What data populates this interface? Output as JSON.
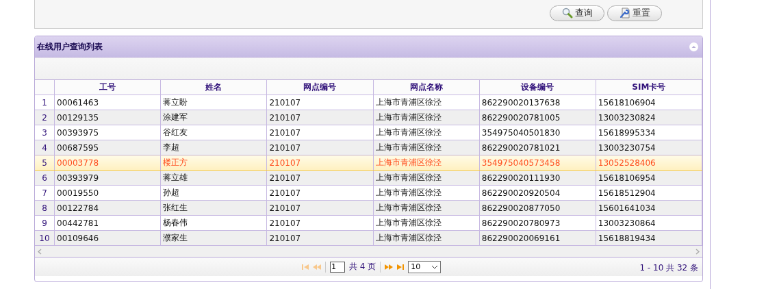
{
  "search_buttons": [
    {
      "kind": "search",
      "label": "查询"
    },
    {
      "kind": "reset",
      "label": "重置"
    }
  ],
  "grid": {
    "title": "在线用户查询列表",
    "columns": [
      "工号",
      "姓名",
      "网点编号",
      "网点名称",
      "设备编号",
      "SIM卡号"
    ],
    "rows": [
      {
        "index": "1",
        "cells": [
          "00061463",
          "蒋立盼",
          "210107",
          "上海市青浦区徐泾",
          "862290020137638",
          "15618106904"
        ],
        "selected": false
      },
      {
        "index": "2",
        "cells": [
          "00129135",
          "涂建军",
          "210107",
          "上海市青浦区徐泾",
          "862290020781005",
          "13003230824"
        ],
        "selected": false
      },
      {
        "index": "3",
        "cells": [
          "00393975",
          "谷红友",
          "210107",
          "上海市青浦区徐泾",
          "354975040501830",
          "15618995334"
        ],
        "selected": false
      },
      {
        "index": "4",
        "cells": [
          "00687595",
          "李超",
          "210107",
          "上海市青浦区徐泾",
          "862290020781021",
          "13003230754"
        ],
        "selected": false
      },
      {
        "index": "5",
        "cells": [
          "00003778",
          "楼正方",
          "210107",
          "上海市青浦区徐泾",
          "354975040573458",
          "13052528406"
        ],
        "selected": true
      },
      {
        "index": "6",
        "cells": [
          "00393979",
          "蒋立雄",
          "210107",
          "上海市青浦区徐泾",
          "862290020111930",
          "15618106954"
        ],
        "selected": false
      },
      {
        "index": "7",
        "cells": [
          "00019550",
          "孙超",
          "210107",
          "上海市青浦区徐泾",
          "862290020920504",
          "15618512904"
        ],
        "selected": false
      },
      {
        "index": "8",
        "cells": [
          "00122784",
          "张红生",
          "210107",
          "上海市青浦区徐泾",
          "862290020877050",
          "15601641034"
        ],
        "selected": false
      },
      {
        "index": "9",
        "cells": [
          "00442781",
          "杨春伟",
          "210107",
          "上海市青浦区徐泾",
          "862290020780973",
          "13003230864"
        ],
        "selected": false
      },
      {
        "index": "10",
        "cells": [
          "00109646",
          "濮家生",
          "210107",
          "上海市青浦区徐泾",
          "862290020069161",
          "15618819434"
        ],
        "selected": false
      }
    ],
    "pager": {
      "page": "1",
      "total_pages": "共 4 页",
      "page_size": "10",
      "summary": "1 - 10  共 32 条"
    }
  }
}
